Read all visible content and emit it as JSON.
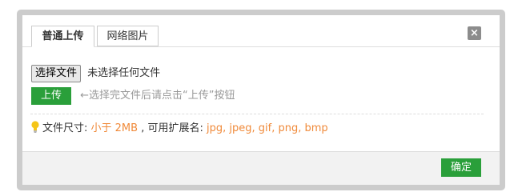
{
  "tabs": [
    {
      "label": "普通上传",
      "active": true
    },
    {
      "label": "网络图片",
      "active": false
    }
  ],
  "close_icon": {
    "glyph": "×",
    "icon": "close-icon"
  },
  "file_input": {
    "button_label": "选择文件",
    "status_text": "未选择任何文件"
  },
  "upload": {
    "button_label": "上传",
    "hint": "←选择完文件后请点击“上传”按钮"
  },
  "info": {
    "icon": "lightbulb-icon",
    "size_label": "文件尺寸:",
    "size_value": "小于 2MB",
    "ext_label": ", 可用扩展名:",
    "ext_value": "jpg, jpeg, gif, png, bmp"
  },
  "footer": {
    "confirm_label": "确定"
  },
  "colors": {
    "accent_green": "#2a9f3a",
    "highlight_orange": "#f08a3a",
    "hint_gray": "#999999",
    "frame_gray": "#cccccc"
  }
}
